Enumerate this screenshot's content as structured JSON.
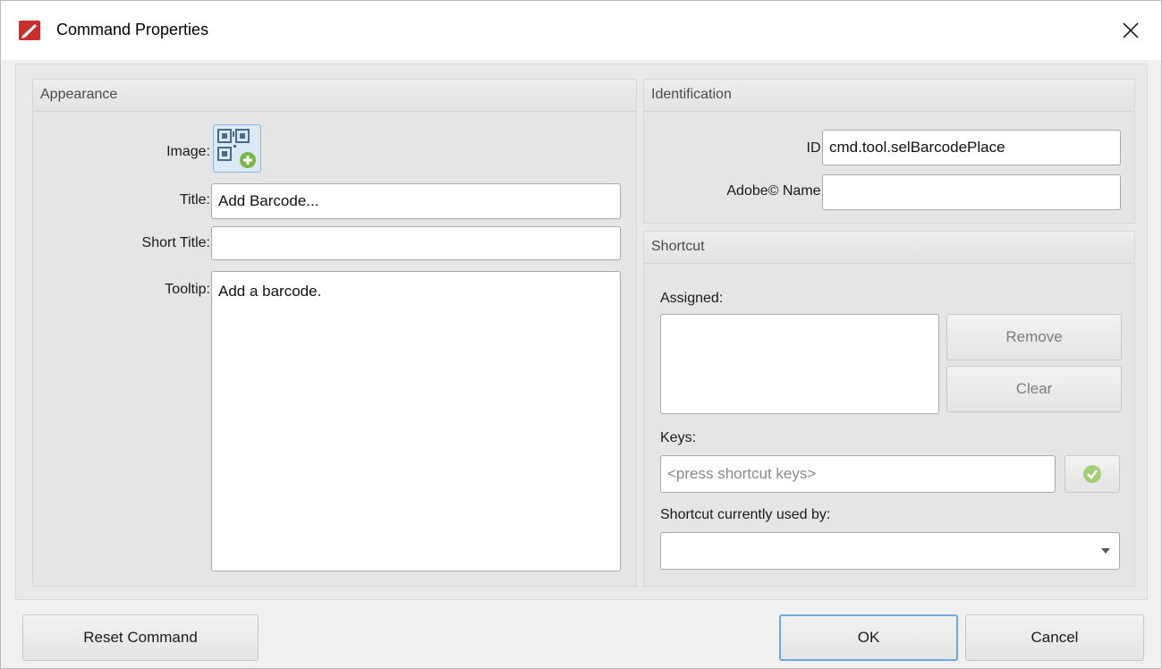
{
  "window": {
    "title": "Command Properties"
  },
  "appearance": {
    "header": "Appearance",
    "image_label": "Image:",
    "title_label": "Title:",
    "title_value": "Add Barcode...",
    "short_title_label": "Short Title:",
    "short_title_value": "",
    "tooltip_label": "Tooltip:",
    "tooltip_value": "Add a barcode."
  },
  "identification": {
    "header": "Identification",
    "id_label": "ID:",
    "id_value": "cmd.tool.selBarcodePlace",
    "adobe_name_label": "Adobe© Name:",
    "adobe_name_value": ""
  },
  "shortcut": {
    "header": "Shortcut",
    "assigned_label": "Assigned:",
    "remove_label": "Remove",
    "clear_label": "Clear",
    "keys_label": "Keys:",
    "keys_placeholder": "<press shortcut keys>",
    "used_by_label": "Shortcut currently used by:",
    "used_by_value": ""
  },
  "footer": {
    "reset_label": "Reset Command",
    "ok_label": "OK",
    "cancel_label": "Cancel"
  },
  "colors": {
    "accent": "#6fa8dc",
    "app_icon": "#c9302c",
    "apply_check": "#8bc34a"
  },
  "icons": {
    "app": "pdf-editor-icon",
    "close": "close-icon",
    "image": "barcode-add-icon",
    "apply": "check-circle-icon",
    "dropdown": "chevron-down-icon"
  }
}
